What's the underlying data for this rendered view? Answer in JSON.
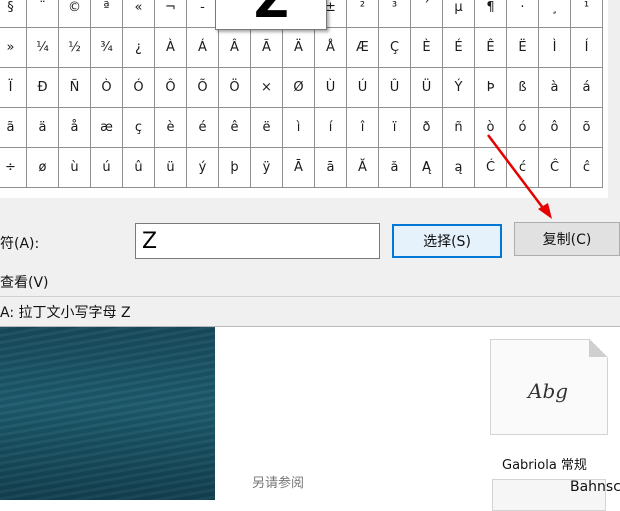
{
  "charmap": {
    "rows": [
      [
        "§",
        "¨",
        "©",
        "ª",
        "«",
        "¬",
        "-",
        "®",
        "¯",
        "°",
        "±",
        "²",
        "³",
        "´",
        "µ",
        "¶",
        "·",
        "¸",
        "¹"
      ],
      [
        "»",
        "¼",
        "½",
        "¾",
        "¿",
        "À",
        "Á",
        "Â",
        "Ã",
        "Ä",
        "Å",
        "Æ",
        "Ç",
        "È",
        "É",
        "Ê",
        "Ë",
        "Ì",
        "Í"
      ],
      [
        "Ï",
        "Ð",
        "Ñ",
        "Ò",
        "Ó",
        "Ô",
        "Õ",
        "Ö",
        "×",
        "Ø",
        "Ù",
        "Ú",
        "Û",
        "Ü",
        "Ý",
        "Þ",
        "ß",
        "à",
        "á"
      ],
      [
        "ã",
        "ä",
        "å",
        "æ",
        "ç",
        "è",
        "é",
        "ê",
        "ë",
        "ì",
        "í",
        "î",
        "ï",
        "ð",
        "ñ",
        "ò",
        "ó",
        "ô",
        "õ"
      ],
      [
        "÷",
        "ø",
        "ù",
        "ú",
        "û",
        "ü",
        "ý",
        "þ",
        "ÿ",
        "Ā",
        "ā",
        "Ă",
        "ă",
        "Ą",
        "ą",
        "Ć",
        "ć",
        "Ĉ",
        "ĉ"
      ]
    ],
    "magnified_char": "Z",
    "copy_label": "符(A):",
    "copy_value": "Z",
    "select_button": "选择(S)",
    "copy_button": "复制(C)",
    "advanced_view": "查看(V)",
    "status_text": "A: 拉丁文小写字母 Z"
  },
  "fonts_panel": {
    "see_also": "另请参阅",
    "font_sample": "Abg",
    "font_name": "Gabriola 常规",
    "font_name2": "Bahnsc"
  },
  "annotation_color": "#e60000"
}
